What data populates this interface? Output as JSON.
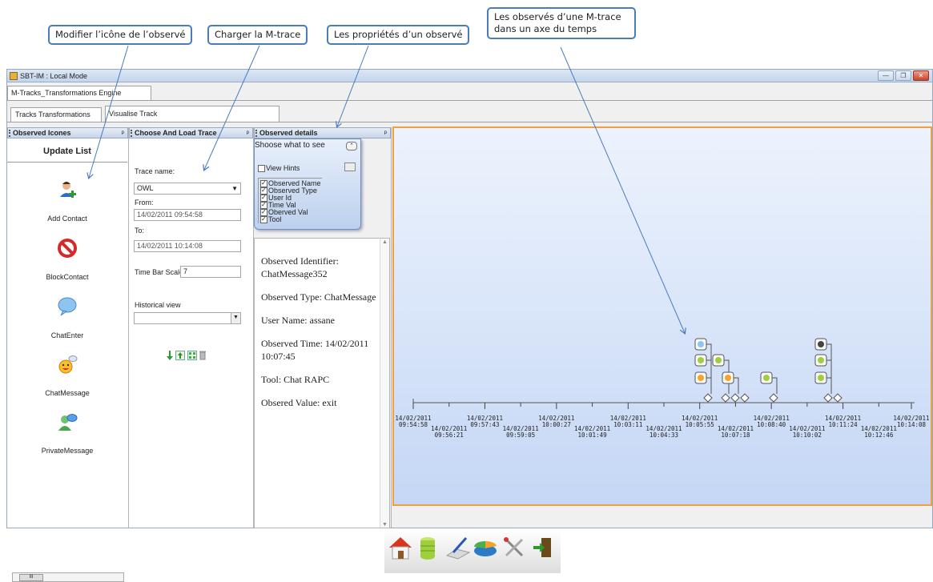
{
  "annotations": {
    "callout1": "Modifier l’icône de l’observé",
    "callout2": "Charger la M-trace",
    "callout3": "Les propriétés d’un observé",
    "callout4_line1": "Les observés d’une M-trace",
    "callout4_line2": "dans un axe du temps"
  },
  "window": {
    "title": "SBT-IM : Local Mode",
    "min_label": "—",
    "max_label": "❐",
    "close_label": "✕"
  },
  "tabs": {
    "top": "M-Tracks_Transformations Engine",
    "sub1": "Tracks Transformations",
    "sub2": "Visualise Track"
  },
  "observed_icons": {
    "header": "Observed Icones",
    "pin": "ᵖ",
    "update_button": "Update List",
    "items": [
      {
        "label": "Add Contact",
        "icon": "add-contact-icon"
      },
      {
        "label": "BlockContact",
        "icon": "block-icon"
      },
      {
        "label": "ChatEnter",
        "icon": "chat-bubble-icon"
      },
      {
        "label": "ChatMessage",
        "icon": "smiley-icon"
      },
      {
        "label": "PrivateMessage",
        "icon": "private-message-icon"
      }
    ],
    "scroll_thumb": "III"
  },
  "trace": {
    "header": "Choose And Load Trace",
    "pin": "ᵖ",
    "name_label": "Trace name:",
    "name_value": "OWL",
    "from_label": "From:",
    "from_value": "14/02/2011 09:54:58",
    "to_label": "To:",
    "to_value": "14/02/2011 10:14:08",
    "scale_label": "Time Bar Scale:",
    "scale_value": "7",
    "history_label": "Historical view",
    "history_value": ""
  },
  "details": {
    "header": "Observed details",
    "pin": "ᵖ",
    "chooser_title": "Shoose what to see",
    "view_hints": "View Hints",
    "options": [
      "Observed Name",
      "Observed Type",
      "User Id",
      "Time Val",
      "Oberved Val",
      "Tool"
    ],
    "lines": [
      "Observed Identifier: ChatMessage352",
      "Observed Type: ChatMessage",
      "User Name: assane",
      "Observed Time: 14/02/2011 10:07:45",
      "Tool: Chat RAPC",
      "Obsered Value: exit"
    ]
  },
  "timeline": {
    "ticks_top": [
      [
        "14/02/2011",
        "09:54:58"
      ],
      [
        "14/02/2011",
        "09:57:43"
      ],
      [
        "14/02/2011",
        "10:00:27"
      ],
      [
        "14/02/2011",
        "10:03:11"
      ],
      [
        "14/02/2011",
        "10:05:55"
      ],
      [
        "14/02/2011",
        "10:08:40"
      ],
      [
        "14/02/2011",
        "10:11:24"
      ],
      [
        "14/02/2011",
        "10:14:08"
      ]
    ],
    "ticks_bottom": [
      [
        "14/02/2011",
        "09:56:21"
      ],
      [
        "14/02/2011",
        "09:59:05"
      ],
      [
        "14/02/2011",
        "10:01:49"
      ],
      [
        "14/02/2011",
        "10:04:33"
      ],
      [
        "14/02/2011",
        "10:07:18"
      ],
      [
        "14/02/2011",
        "10:10:02"
      ],
      [
        "14/02/2011",
        "10:12:46"
      ]
    ]
  },
  "taskbar": {
    "icons": [
      "home-icon",
      "database-icon",
      "edit-icon",
      "chart-icon",
      "tools-icon",
      "exit-door-icon"
    ]
  }
}
